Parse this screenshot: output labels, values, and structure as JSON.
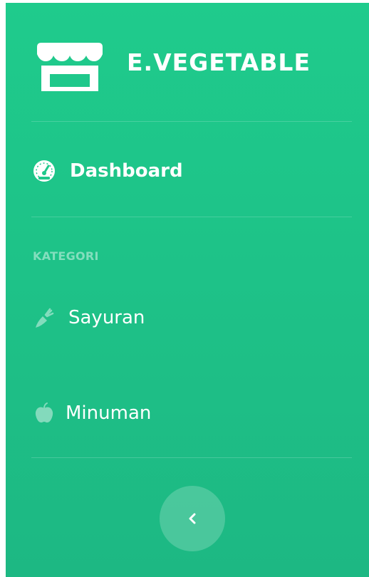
{
  "brand": {
    "name": "E.VEGETABLE",
    "icon": "store-icon"
  },
  "nav": {
    "dashboard": {
      "label": "Dashboard",
      "icon": "tachometer-icon"
    }
  },
  "kategori": {
    "heading": "KATEGORI",
    "items": [
      {
        "label": "Sayuran",
        "icon": "carrot-icon"
      },
      {
        "label": "Minuman",
        "icon": "apple-icon"
      }
    ]
  },
  "toggle": {
    "icon": "chevron-left-icon"
  },
  "colors": {
    "sidebar_top": "#1fcb8c",
    "sidebar_bottom": "#1db883",
    "text": "#ffffff"
  }
}
